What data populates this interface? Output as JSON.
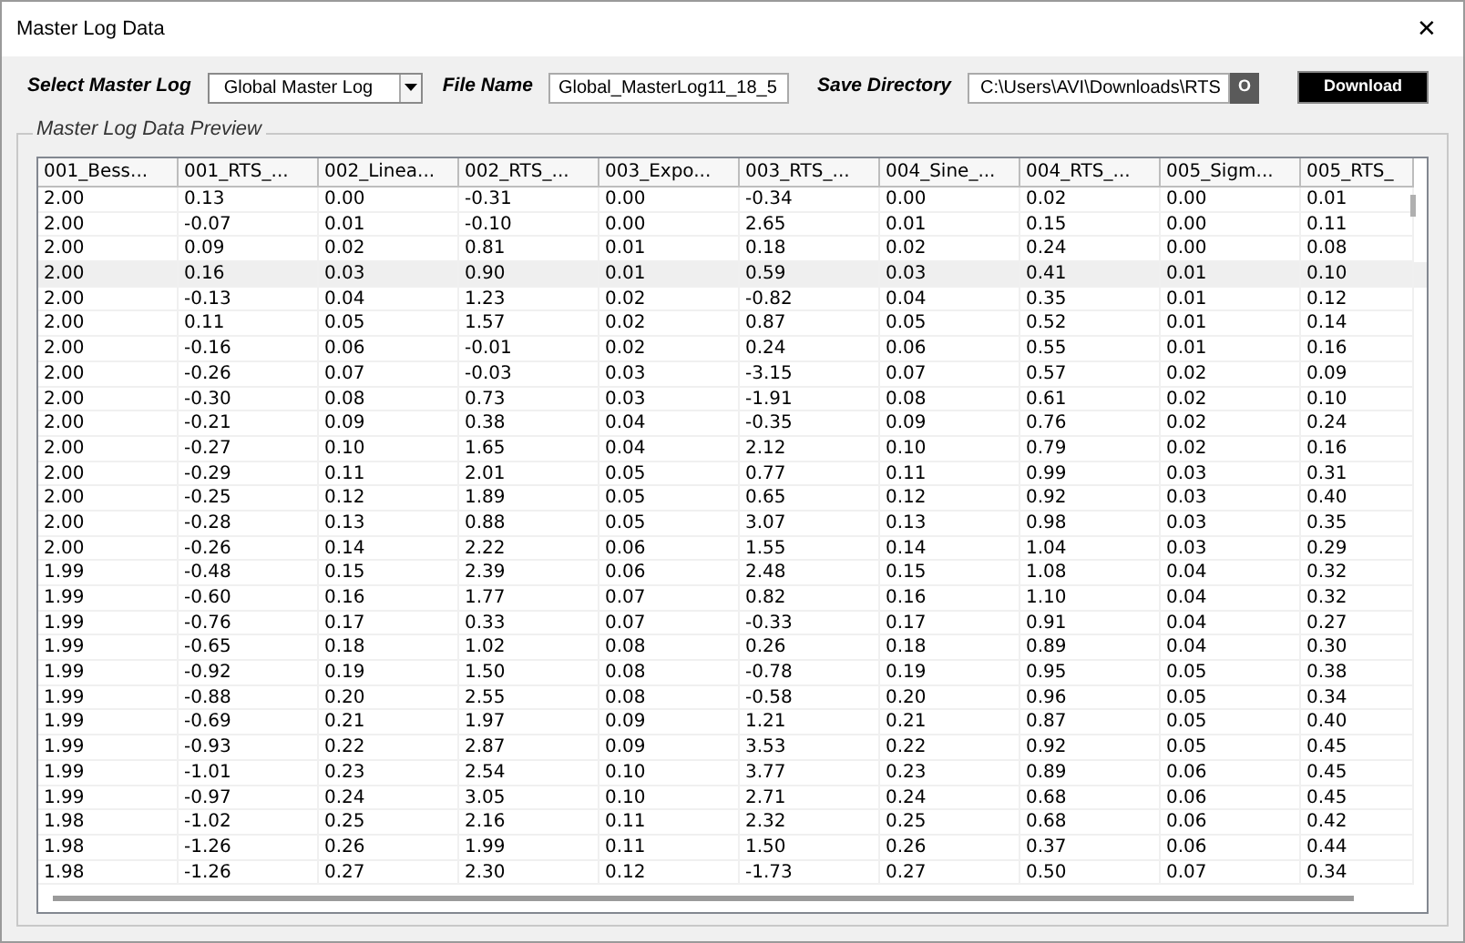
{
  "window": {
    "title": "Master Log Data",
    "close": "✕"
  },
  "controls": {
    "master_log_label": "Select Master Log",
    "master_log_value": "Global Master Log",
    "file_name_label": "File Name",
    "file_name_value": "Global_MasterLog11_18_5",
    "save_directory_label": "Save Directory",
    "save_directory_value": "C:\\Users\\AVI\\Downloads\\RTS",
    "browse_button": "O",
    "download_button": "Download"
  },
  "preview": {
    "title": "Master Log Data Preview",
    "columns": [
      "001_Bess...",
      "001_RTS_...",
      "002_Linea...",
      "002_RTS_...",
      "003_Expo...",
      "003_RTS_...",
      "004_Sine_...",
      "004_RTS_...",
      "005_Sigm...",
      "005_RTS_"
    ],
    "rows": [
      {
        "selected": false,
        "cells": [
          "2.00",
          "0.13",
          "0.00",
          "-0.31",
          "0.00",
          "-0.34",
          "0.00",
          "0.02",
          "0.00",
          "0.01"
        ]
      },
      {
        "selected": false,
        "cells": [
          "2.00",
          "-0.07",
          "0.01",
          "-0.10",
          "0.00",
          "2.65",
          "0.01",
          "0.15",
          "0.00",
          "0.11"
        ]
      },
      {
        "selected": false,
        "cells": [
          "2.00",
          "0.09",
          "0.02",
          "0.81",
          "0.01",
          "0.18",
          "0.02",
          "0.24",
          "0.00",
          "0.08"
        ]
      },
      {
        "selected": true,
        "cells": [
          "2.00",
          "0.16",
          "0.03",
          "0.90",
          "0.01",
          "0.59",
          "0.03",
          "0.41",
          "0.01",
          "0.10"
        ]
      },
      {
        "selected": false,
        "cells": [
          "2.00",
          "-0.13",
          "0.04",
          "1.23",
          "0.02",
          "-0.82",
          "0.04",
          "0.35",
          "0.01",
          "0.12"
        ]
      },
      {
        "selected": false,
        "cells": [
          "2.00",
          "0.11",
          "0.05",
          "1.57",
          "0.02",
          "0.87",
          "0.05",
          "0.52",
          "0.01",
          "0.14"
        ]
      },
      {
        "selected": false,
        "cells": [
          "2.00",
          "-0.16",
          "0.06",
          "-0.01",
          "0.02",
          "0.24",
          "0.06",
          "0.55",
          "0.01",
          "0.16"
        ]
      },
      {
        "selected": false,
        "cells": [
          "2.00",
          "-0.26",
          "0.07",
          "-0.03",
          "0.03",
          "-3.15",
          "0.07",
          "0.57",
          "0.02",
          "0.09"
        ]
      },
      {
        "selected": false,
        "cells": [
          "2.00",
          "-0.30",
          "0.08",
          "0.73",
          "0.03",
          "-1.91",
          "0.08",
          "0.61",
          "0.02",
          "0.10"
        ]
      },
      {
        "selected": false,
        "cells": [
          "2.00",
          "-0.21",
          "0.09",
          "0.38",
          "0.04",
          "-0.35",
          "0.09",
          "0.76",
          "0.02",
          "0.24"
        ]
      },
      {
        "selected": false,
        "cells": [
          "2.00",
          "-0.27",
          "0.10",
          "1.65",
          "0.04",
          "2.12",
          "0.10",
          "0.79",
          "0.02",
          "0.16"
        ]
      },
      {
        "selected": false,
        "cells": [
          "2.00",
          "-0.29",
          "0.11",
          "2.01",
          "0.05",
          "0.77",
          "0.11",
          "0.99",
          "0.03",
          "0.31"
        ]
      },
      {
        "selected": false,
        "cells": [
          "2.00",
          "-0.25",
          "0.12",
          "1.89",
          "0.05",
          "0.65",
          "0.12",
          "0.92",
          "0.03",
          "0.40"
        ]
      },
      {
        "selected": false,
        "cells": [
          "2.00",
          "-0.28",
          "0.13",
          "0.88",
          "0.05",
          "3.07",
          "0.13",
          "0.98",
          "0.03",
          "0.35"
        ]
      },
      {
        "selected": false,
        "cells": [
          "2.00",
          "-0.26",
          "0.14",
          "2.22",
          "0.06",
          "1.55",
          "0.14",
          "1.04",
          "0.03",
          "0.29"
        ]
      },
      {
        "selected": false,
        "cells": [
          "1.99",
          "-0.48",
          "0.15",
          "2.39",
          "0.06",
          "2.48",
          "0.15",
          "1.08",
          "0.04",
          "0.32"
        ]
      },
      {
        "selected": false,
        "cells": [
          "1.99",
          "-0.60",
          "0.16",
          "1.77",
          "0.07",
          "0.82",
          "0.16",
          "1.10",
          "0.04",
          "0.32"
        ]
      },
      {
        "selected": false,
        "cells": [
          "1.99",
          "-0.76",
          "0.17",
          "0.33",
          "0.07",
          "-0.33",
          "0.17",
          "0.91",
          "0.04",
          "0.27"
        ]
      },
      {
        "selected": false,
        "cells": [
          "1.99",
          "-0.65",
          "0.18",
          "1.02",
          "0.08",
          "0.26",
          "0.18",
          "0.89",
          "0.04",
          "0.30"
        ]
      },
      {
        "selected": false,
        "cells": [
          "1.99",
          "-0.92",
          "0.19",
          "1.50",
          "0.08",
          "-0.78",
          "0.19",
          "0.95",
          "0.05",
          "0.38"
        ]
      },
      {
        "selected": false,
        "cells": [
          "1.99",
          "-0.88",
          "0.20",
          "2.55",
          "0.08",
          "-0.58",
          "0.20",
          "0.96",
          "0.05",
          "0.34"
        ]
      },
      {
        "selected": false,
        "cells": [
          "1.99",
          "-0.69",
          "0.21",
          "1.97",
          "0.09",
          "1.21",
          "0.21",
          "0.87",
          "0.05",
          "0.40"
        ]
      },
      {
        "selected": false,
        "cells": [
          "1.99",
          "-0.93",
          "0.22",
          "2.87",
          "0.09",
          "3.53",
          "0.22",
          "0.92",
          "0.05",
          "0.45"
        ]
      },
      {
        "selected": false,
        "cells": [
          "1.99",
          "-1.01",
          "0.23",
          "2.54",
          "0.10",
          "3.77",
          "0.23",
          "0.89",
          "0.06",
          "0.45"
        ]
      },
      {
        "selected": false,
        "cells": [
          "1.99",
          "-0.97",
          "0.24",
          "3.05",
          "0.10",
          "2.71",
          "0.24",
          "0.68",
          "0.06",
          "0.45"
        ]
      },
      {
        "selected": false,
        "cells": [
          "1.98",
          "-1.02",
          "0.25",
          "2.16",
          "0.11",
          "2.32",
          "0.25",
          "0.68",
          "0.06",
          "0.42"
        ]
      },
      {
        "selected": false,
        "cells": [
          "1.98",
          "-1.26",
          "0.26",
          "1.99",
          "0.11",
          "1.50",
          "0.26",
          "0.37",
          "0.06",
          "0.44"
        ]
      },
      {
        "selected": false,
        "cells": [
          "1.98",
          "-1.26",
          "0.27",
          "2.30",
          "0.12",
          "-1.73",
          "0.27",
          "0.50",
          "0.07",
          "0.34"
        ]
      }
    ]
  }
}
